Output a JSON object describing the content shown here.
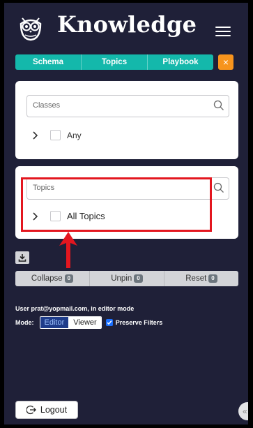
{
  "header": {
    "brand": "Knowledge",
    "logo_icon": "owl-logo-icon",
    "menu_icon": "hamburger-menu-icon"
  },
  "tabs": [
    {
      "label": "Schema"
    },
    {
      "label": "Topics"
    },
    {
      "label": "Playbook"
    }
  ],
  "close_button": {
    "label": "×"
  },
  "classes_card": {
    "search_placeholder": "Classes",
    "tree_item_label": "Any"
  },
  "topics_card": {
    "search_placeholder": "Topics",
    "tree_item_label": "All Topics"
  },
  "actions": [
    {
      "label": "Collapse",
      "count": "0"
    },
    {
      "label": "Unpin",
      "count": "0"
    },
    {
      "label": "Reset",
      "count": "0"
    }
  ],
  "status": {
    "user_line": "User prat@yopmail.com, in editor mode",
    "mode_label": "Mode:",
    "mode_options": [
      "Editor",
      "Viewer"
    ],
    "selected_mode": "Editor",
    "preserve_filters_label": "Preserve Filters",
    "preserve_filters_checked": true
  },
  "logout": {
    "label": "Logout"
  },
  "sidebar_toggle": {
    "label": "«"
  },
  "colors": {
    "background": "#1f2038",
    "tab_accent": "#14b8ab",
    "close_accent": "#f7941d",
    "highlight": "#e3161f"
  }
}
